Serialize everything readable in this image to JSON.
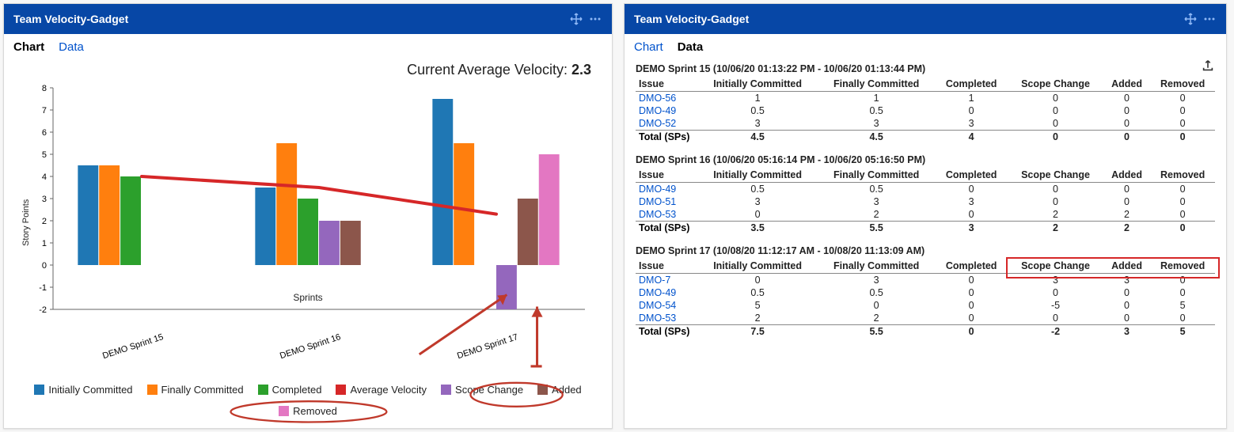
{
  "chart_data": {
    "type": "bar",
    "title": "",
    "xlabel": "Sprints",
    "ylabel": "Story Points",
    "ylim": [
      -2,
      8
    ],
    "categories": [
      "DEMO Sprint 15",
      "DEMO Sprint 16",
      "DEMO Sprint 17"
    ],
    "series": [
      {
        "name": "Initially Committed",
        "color": "#1f77b4",
        "values": [
          4.5,
          3.5,
          7.5
        ]
      },
      {
        "name": "Finally Committed",
        "color": "#ff7f0e",
        "values": [
          4.5,
          5.5,
          5.5
        ]
      },
      {
        "name": "Completed",
        "color": "#2ca02c",
        "values": [
          4,
          3,
          0
        ]
      },
      {
        "name": "Scope Change",
        "color": "#9467bd",
        "values": [
          0,
          2,
          -2
        ]
      },
      {
        "name": "Added",
        "color": "#8c564b",
        "values": [
          0,
          2,
          3
        ]
      },
      {
        "name": "Removed",
        "color": "#e377c2",
        "values": [
          0,
          0,
          5
        ]
      }
    ],
    "overlay_line": {
      "name": "Average Velocity",
      "color": "#d62728",
      "values": [
        4,
        3.5,
        2.3
      ]
    }
  },
  "gadget": {
    "title": "Team Velocity-Gadget"
  },
  "tabs": {
    "chart": "Chart",
    "data": "Data"
  },
  "velocity": {
    "label": "Current Average Velocity: ",
    "value": "2.3"
  },
  "legend": {
    "initially_committed": "Initially Committed",
    "finally_committed": "Finally Committed",
    "completed": "Completed",
    "average_velocity": "Average Velocity",
    "scope_change": "Scope Change",
    "added": "Added",
    "removed": "Removed"
  },
  "columns": {
    "issue": "Issue",
    "initially_committed": "Initially Committed",
    "finally_committed": "Finally Committed",
    "completed": "Completed",
    "scope_change": "Scope Change",
    "added": "Added",
    "removed": "Removed",
    "total": "Total (SPs)"
  },
  "sprints": [
    {
      "title": "DEMO Sprint 15 (10/06/20 01:13:22 PM - 10/06/20 01:13:44 PM)",
      "rows": [
        {
          "issue": "DMO-56",
          "ic": "1",
          "fc": "1",
          "comp": "1",
          "sc": "0",
          "add": "0",
          "rem": "0"
        },
        {
          "issue": "DMO-49",
          "ic": "0.5",
          "fc": "0.5",
          "comp": "0",
          "sc": "0",
          "add": "0",
          "rem": "0"
        },
        {
          "issue": "DMO-52",
          "ic": "3",
          "fc": "3",
          "comp": "3",
          "sc": "0",
          "add": "0",
          "rem": "0"
        }
      ],
      "total": {
        "ic": "4.5",
        "fc": "4.5",
        "comp": "4",
        "sc": "0",
        "add": "0",
        "rem": "0"
      }
    },
    {
      "title": "DEMO Sprint 16 (10/06/20 05:16:14 PM - 10/06/20 05:16:50 PM)",
      "rows": [
        {
          "issue": "DMO-49",
          "ic": "0.5",
          "fc": "0.5",
          "comp": "0",
          "sc": "0",
          "add": "0",
          "rem": "0"
        },
        {
          "issue": "DMO-51",
          "ic": "3",
          "fc": "3",
          "comp": "3",
          "sc": "0",
          "add": "0",
          "rem": "0"
        },
        {
          "issue": "DMO-53",
          "ic": "0",
          "fc": "2",
          "comp": "0",
          "sc": "2",
          "add": "2",
          "rem": "0"
        }
      ],
      "total": {
        "ic": "3.5",
        "fc": "5.5",
        "comp": "3",
        "sc": "2",
        "add": "2",
        "rem": "0"
      }
    },
    {
      "title": "DEMO Sprint 17 (10/08/20 11:12:17 AM - 10/08/20 11:13:09 AM)",
      "rows": [
        {
          "issue": "DMO-7",
          "ic": "0",
          "fc": "3",
          "comp": "0",
          "sc": "3",
          "add": "3",
          "rem": "0"
        },
        {
          "issue": "DMO-49",
          "ic": "0.5",
          "fc": "0.5",
          "comp": "0",
          "sc": "0",
          "add": "0",
          "rem": "0"
        },
        {
          "issue": "DMO-54",
          "ic": "5",
          "fc": "0",
          "comp": "0",
          "sc": "-5",
          "add": "0",
          "rem": "5"
        },
        {
          "issue": "DMO-53",
          "ic": "2",
          "fc": "2",
          "comp": "0",
          "sc": "0",
          "add": "0",
          "rem": "0"
        }
      ],
      "total": {
        "ic": "7.5",
        "fc": "5.5",
        "comp": "0",
        "sc": "-2",
        "add": "3",
        "rem": "5"
      }
    }
  ]
}
